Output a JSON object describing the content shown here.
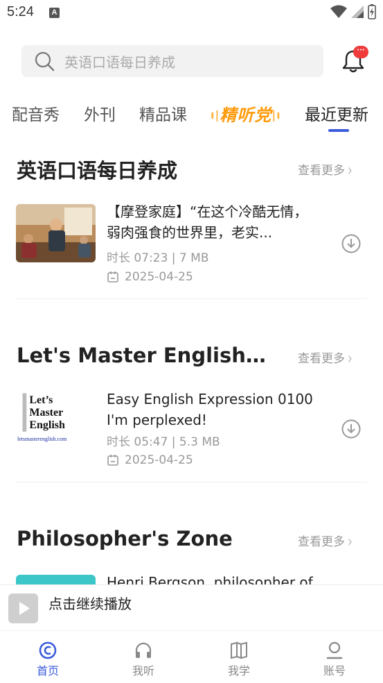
{
  "status_bar": {
    "time": "5:24",
    "a_badge": "A"
  },
  "search": {
    "placeholder": "英语口语每日养成",
    "notification_badge": "···"
  },
  "tabs": [
    {
      "label": "配音秀"
    },
    {
      "label": "外刊"
    },
    {
      "label": "精品课"
    },
    {
      "label": "精听党"
    },
    {
      "label": "最近更新",
      "active": true
    }
  ],
  "sections": [
    {
      "title": "英语口语每日养成",
      "more_label": "查看更多",
      "episode": {
        "title": "【摩登家庭】“在这个冷酷无情，弱肉强食的世界里，老实...",
        "meta": "时长 07:23 | 7 MB",
        "date": "2025-04-25"
      }
    },
    {
      "title": "Let's Master English! An...",
      "more_label": "查看更多",
      "episode": {
        "title": "Easy English Expression 0100 I'm perplexed!",
        "meta": "时长 05:47 | 5.3 MB",
        "date": "2025-04-25",
        "thumb_lines": [
          "Let’s",
          "Master",
          "English",
          "letsmasterenglish.com"
        ]
      }
    },
    {
      "title": "Philosopher's Zone",
      "more_label": "查看更多",
      "episode": {
        "title": "Henri Bergson, philosopher of"
      }
    }
  ],
  "mini_player": {
    "label": "点击继续播放"
  },
  "bottom_nav": [
    {
      "label": "首页",
      "icon": "home-icon",
      "active": true
    },
    {
      "label": "我听",
      "icon": "headphones-icon"
    },
    {
      "label": "我学",
      "icon": "book-icon"
    },
    {
      "label": "账号",
      "icon": "account-icon"
    }
  ],
  "colors": {
    "accent": "#3b5bdb",
    "badge": "#ef3b3b",
    "special_tab": "#ff9b0d"
  }
}
